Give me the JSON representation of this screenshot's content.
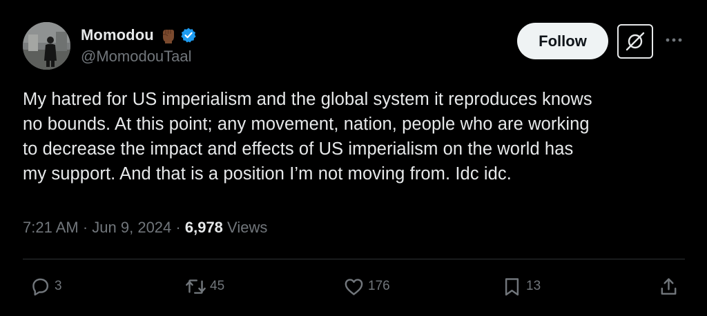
{
  "author": {
    "display_name": "Momodou",
    "emoji": "raised-fist-dark-skin",
    "verified": true,
    "handle": "@MomodouTaal"
  },
  "header_actions": {
    "follow_label": "Follow",
    "grok_icon": "grok-icon",
    "more_icon": "more-icon"
  },
  "tweet": {
    "text": "My hatred for US imperialism and the global system it reproduces knows\nno bounds. At this point; any movement, nation, people who are working\nto decrease the impact and effects of US imperialism on the world has\nmy support. And that is a position I’m not moving from. Idc idc."
  },
  "meta": {
    "time": "7:21 AM",
    "date": "Jun 9, 2024",
    "separator": "·",
    "views_count": "6,978",
    "views_label": "Views"
  },
  "actions": {
    "replies": "3",
    "reposts": "45",
    "likes": "176",
    "bookmarks": "13"
  },
  "colors": {
    "background": "#000000",
    "text": "#e7e9ea",
    "muted": "#71767b",
    "verified_blue": "#1d9bf0",
    "divider": "#2f3336"
  }
}
